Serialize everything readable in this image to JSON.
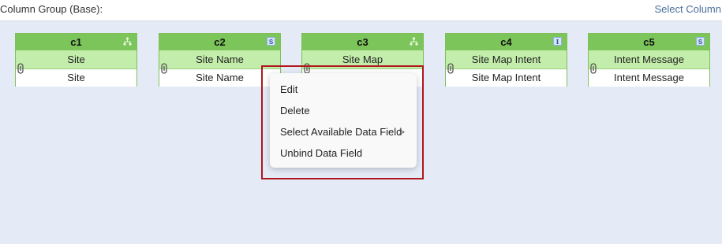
{
  "header": {
    "title": "Column Group (Base):",
    "select_columns_link": "Select Column"
  },
  "columns": [
    {
      "name": "c1",
      "field": "Site",
      "bound_field": "Site",
      "type_icon": "hierarchy-icon",
      "type_label": ""
    },
    {
      "name": "c2",
      "field": "Site Name",
      "bound_field": "Site Name",
      "type_icon": "string-type-icon",
      "type_label": "S"
    },
    {
      "name": "c3",
      "field": "Site Map",
      "bound_field": "",
      "type_icon": "hierarchy-icon",
      "type_label": ""
    },
    {
      "name": "c4",
      "field": "Site Map Intent",
      "bound_field": "Site Map Intent",
      "type_icon": "integer-type-icon",
      "type_label": "I"
    },
    {
      "name": "c5",
      "field": "Intent Message",
      "bound_field": "Intent Message",
      "type_icon": "string-type-icon",
      "type_label": "S"
    }
  ],
  "context_menu": {
    "items": [
      {
        "label": "Edit"
      },
      {
        "label": "Delete"
      },
      {
        "label": "Select Available Data Field",
        "submenu_arrow": ">"
      },
      {
        "label": "Unbind Data Field"
      }
    ]
  },
  "colors": {
    "header_green": "#7cc55a",
    "field_green": "#c3edaa",
    "highlight_red": "#b0161c",
    "canvas_bg": "#e4ebf7"
  }
}
